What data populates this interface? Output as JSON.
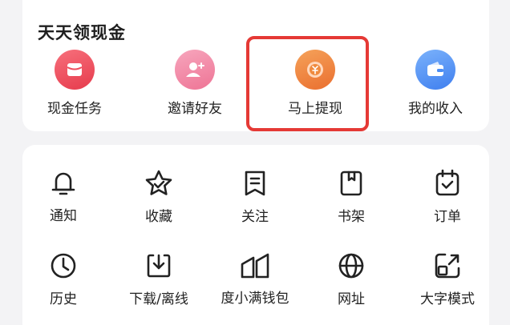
{
  "cash_section": {
    "title": "天天领现金",
    "items": [
      {
        "label": "现金任务",
        "icon": "red-envelope-icon",
        "color": "#ef4f5e"
      },
      {
        "label": "邀请好友",
        "icon": "invite-user-icon",
        "color": "#f18aa6"
      },
      {
        "label": "马上提现",
        "icon": "coin-withdraw-icon",
        "color": "#f08a3e"
      },
      {
        "label": "我的收入",
        "icon": "wallet-icon",
        "color": "#4a8df6"
      }
    ],
    "highlight_color": "#e53935"
  },
  "tools": [
    {
      "label": "通知",
      "icon": "bell-icon"
    },
    {
      "label": "收藏",
      "icon": "star-icon"
    },
    {
      "label": "关注",
      "icon": "bookmark-icon"
    },
    {
      "label": "书架",
      "icon": "book-icon"
    },
    {
      "label": "订单",
      "icon": "order-icon"
    },
    {
      "label": "历史",
      "icon": "clock-icon"
    },
    {
      "label": "下载/离线",
      "icon": "download-icon"
    },
    {
      "label": "度小满钱包",
      "icon": "du-wallet-icon"
    },
    {
      "label": "网址",
      "icon": "globe-icon"
    },
    {
      "label": "大字模式",
      "icon": "large-font-icon"
    }
  ]
}
